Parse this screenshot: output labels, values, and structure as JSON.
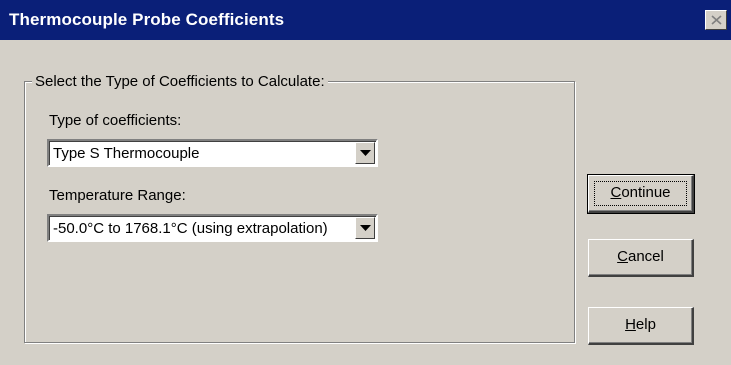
{
  "window": {
    "title": "Thermocouple Probe Coefficients"
  },
  "group": {
    "legend": "Select the Type of Coefficients to Calculate:",
    "type_label": "Type of coefficients:",
    "type_value": "Type S Thermocouple",
    "range_label": "Temperature Range:",
    "range_value": "-50.0°C to 1768.1°C (using extrapolation)"
  },
  "buttons": {
    "continue_mnemonic": "C",
    "continue_rest": "ontinue",
    "cancel_mnemonic": "C",
    "cancel_rest": "ancel",
    "help_mnemonic": "H",
    "help_rest": "elp"
  },
  "icons": {
    "close": "close-icon",
    "dropdown": "triangle-down-icon"
  }
}
